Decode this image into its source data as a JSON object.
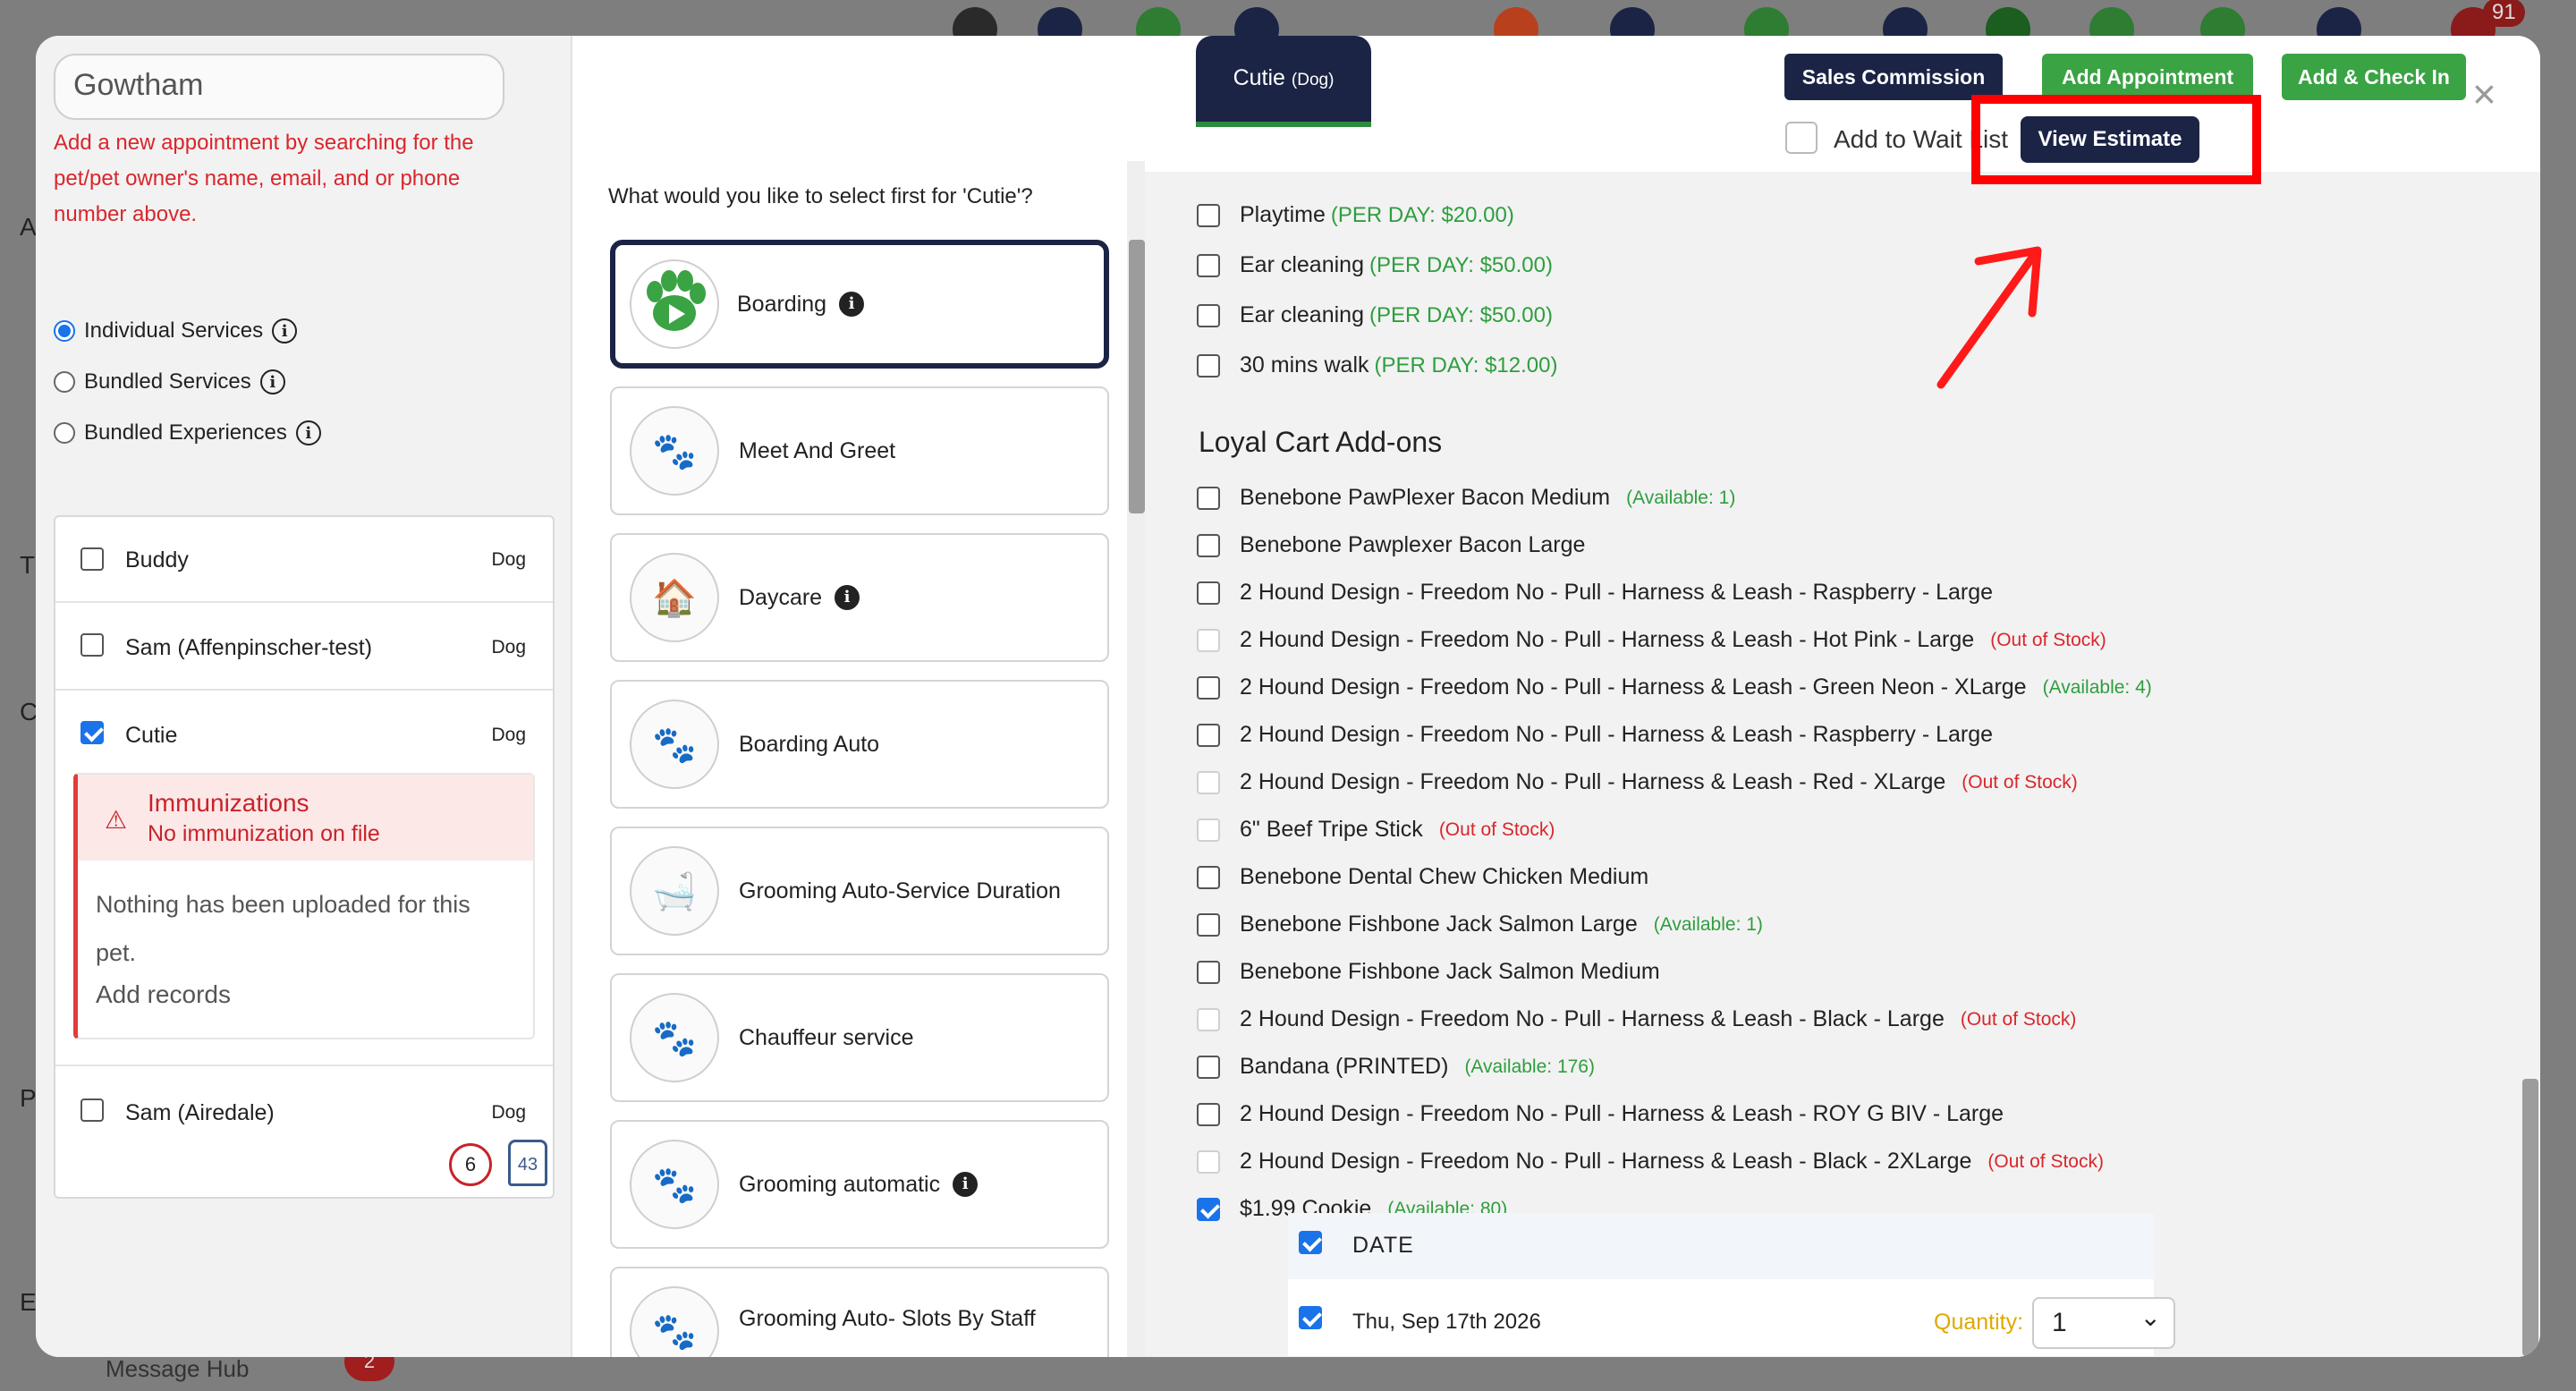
{
  "background": {
    "letters": [
      "A",
      "T",
      "C",
      "P",
      "E"
    ],
    "notification_count": "91",
    "message_hub_label": "Message Hub",
    "message_hub_count": "2"
  },
  "search": {
    "value": "Gowtham"
  },
  "hint": "Add a new appointment by searching for the pet/pet owner's name, email, and or phone number above.",
  "service_types": [
    {
      "label": "Individual Services",
      "selected": true
    },
    {
      "label": "Bundled Services",
      "selected": false
    },
    {
      "label": "Bundled Experiences",
      "selected": false
    }
  ],
  "pets": [
    {
      "name": "Buddy",
      "species": "Dog",
      "checked": false
    },
    {
      "name": "Sam (Affenpinscher-test)",
      "species": "Dog",
      "checked": false
    },
    {
      "name": "Cutie",
      "species": "Dog",
      "checked": true
    },
    {
      "name": "Sam (Airedale)",
      "species": "Dog",
      "checked": false
    }
  ],
  "immunization": {
    "title": "Immunizations",
    "subtitle": "No immunization on file",
    "body": "Nothing has been uploaded for this pet.",
    "link": "Add records"
  },
  "pet_badges": {
    "visits": "6",
    "weight": "43"
  },
  "question": "What would you like to select first for 'Cutie'?",
  "services": [
    {
      "label": "Boarding",
      "info": true,
      "selected": true,
      "icon": "paw-play-icon"
    },
    {
      "label": "Meet And Greet",
      "info": false,
      "selected": false,
      "icon": "paw-icon"
    },
    {
      "label": "Daycare",
      "info": true,
      "selected": false,
      "icon": "daycare-icon"
    },
    {
      "label": "Boarding Auto",
      "info": false,
      "selected": false,
      "icon": "paw-icon"
    },
    {
      "label": "Grooming Auto-Service Duration",
      "info": false,
      "selected": false,
      "icon": "grooming-icon"
    },
    {
      "label": "Chauffeur service",
      "info": false,
      "selected": false,
      "icon": "paw-icon"
    },
    {
      "label": "Grooming automatic",
      "info": true,
      "selected": false,
      "icon": "paw-icon"
    },
    {
      "label": "Grooming Auto- Slots By Staff",
      "info": false,
      "selected": false,
      "icon": "paw-icon"
    }
  ],
  "pet_tab": {
    "name": "Cutie",
    "species": "(Dog)"
  },
  "buttons": {
    "sales_commission": "Sales Commission",
    "add_appointment": "Add Appointment",
    "add_check_in": "Add & Check In",
    "close": "×",
    "add_to_wait_list": "Add to Wait List",
    "view_estimate": "View Estimate"
  },
  "addons_daily": [
    {
      "label": "Playtime",
      "price": "(PER DAY: $20.00)"
    },
    {
      "label": "Ear cleaning",
      "price": "(PER DAY: $50.00)"
    },
    {
      "label": "Ear cleaning",
      "price": "(PER DAY: $50.00)"
    },
    {
      "label": "30 mins walk",
      "price": "(PER DAY: $12.00)"
    }
  ],
  "loyal_cart_title": "Loyal Cart Add-ons",
  "loyal_cart": [
    {
      "label": "Benebone PawPlexer Bacon Medium",
      "note": "(Available: 1)",
      "status": "available",
      "checked": false
    },
    {
      "label": "Benebone Pawplexer Bacon Large",
      "note": "",
      "status": "",
      "checked": false
    },
    {
      "label": "2 Hound Design - Freedom No - Pull - Harness & Leash - Raspberry - Large",
      "note": "",
      "status": "",
      "checked": false
    },
    {
      "label": "2 Hound Design - Freedom No - Pull - Harness & Leash - Hot Pink - Large",
      "note": "(Out of Stock)",
      "status": "out",
      "checked": false
    },
    {
      "label": "2 Hound Design - Freedom No - Pull - Harness & Leash - Green Neon - XLarge",
      "note": "(Available: 4)",
      "status": "available",
      "checked": false
    },
    {
      "label": "2 Hound Design - Freedom No - Pull - Harness & Leash - Raspberry - Large",
      "note": "",
      "status": "",
      "checked": false
    },
    {
      "label": "2 Hound Design - Freedom No - Pull - Harness & Leash - Red - XLarge",
      "note": "(Out of Stock)",
      "status": "out",
      "checked": false
    },
    {
      "label": "6\" Beef Tripe Stick",
      "note": "(Out of Stock)",
      "status": "out",
      "checked": false
    },
    {
      "label": "Benebone Dental Chew Chicken Medium",
      "note": "",
      "status": "",
      "checked": false
    },
    {
      "label": "Benebone Fishbone Jack Salmon Large",
      "note": "(Available: 1)",
      "status": "available",
      "checked": false
    },
    {
      "label": "Benebone Fishbone Jack Salmon Medium",
      "note": "",
      "status": "",
      "checked": false
    },
    {
      "label": "2 Hound Design - Freedom No - Pull - Harness & Leash - Black - Large",
      "note": "(Out of Stock)",
      "status": "out",
      "checked": false
    },
    {
      "label": "Bandana (PRINTED)",
      "note": "(Available: 176)",
      "status": "available",
      "checked": false
    },
    {
      "label": "2 Hound Design - Freedom No - Pull - Harness & Leash - ROY G BIV - Large",
      "note": "",
      "status": "",
      "checked": false
    },
    {
      "label": "2 Hound Design - Freedom No - Pull - Harness & Leash - Black - 2XLarge",
      "note": "(Out of Stock)",
      "status": "out",
      "checked": false
    },
    {
      "label": "$1.99 Cookie",
      "note": "(Available: 80)",
      "status": "available",
      "checked": true
    }
  ],
  "date_section": {
    "header": "DATE",
    "date": "Thu, Sep 17th 2026",
    "quantity_label": "Quantity:",
    "quantity": "1"
  },
  "colors": {
    "navy": "#1b2445",
    "green": "#3aa344",
    "red": "#d9262c",
    "highlight": "#ff0000"
  }
}
